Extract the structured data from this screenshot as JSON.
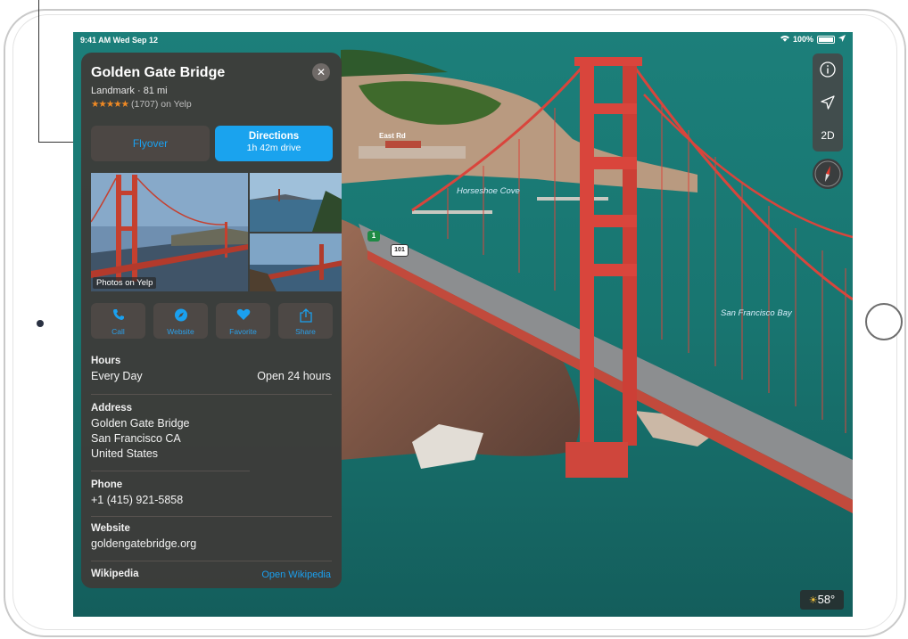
{
  "status": {
    "time_date": "9:41 AM  Wed Sep 12",
    "battery": "100%"
  },
  "place": {
    "title": "Golden Gate Bridge",
    "subtitle": "Landmark · 81 mi",
    "stars": "★★★★★",
    "rating_text": "(1707) on Yelp",
    "flyover_label": "Flyover",
    "directions_label": "Directions",
    "directions_time": "1h 42m drive",
    "photos_label": "Photos on Yelp",
    "actions": [
      {
        "label": "Call",
        "icon": "phone-icon"
      },
      {
        "label": "Website",
        "icon": "compass-icon"
      },
      {
        "label": "Favorite",
        "icon": "heart-icon"
      },
      {
        "label": "Share",
        "icon": "share-icon"
      }
    ],
    "hours_label": "Hours",
    "hours_day": "Every Day",
    "hours_value": "Open 24 hours",
    "address_label": "Address",
    "address_line1": "Golden Gate Bridge",
    "address_line2": "San Francisco CA",
    "address_line3": "United States",
    "phone_label": "Phone",
    "phone_value": "+1 (415) 921-5858",
    "website_label": "Website",
    "website_value": "goldengatebridge.org",
    "wikipedia_label": "Wikipedia",
    "wikipedia_link": "Open Wikipedia"
  },
  "map": {
    "labels": [
      "East Rd",
      "Horseshoe Cove",
      "San Francisco Bay"
    ],
    "route_shield": "1",
    "route_101": "101",
    "controls": {
      "info": "info-icon",
      "location": "location-arrow-icon",
      "view_toggle": "2D"
    },
    "weather": "58°",
    "accent": "#1aa3ee",
    "bridge_color": "#d9453c"
  }
}
